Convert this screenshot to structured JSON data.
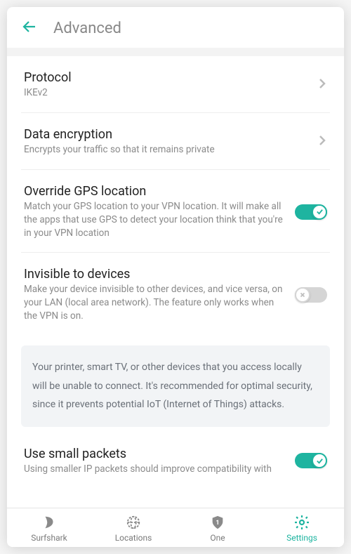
{
  "header": {
    "title": "Advanced"
  },
  "rows": {
    "protocol": {
      "title": "Protocol",
      "sub": "IKEv2"
    },
    "encryption": {
      "title": "Data encryption",
      "sub": "Encrypts your traffic so that it remains private"
    },
    "gps": {
      "title": "Override GPS location",
      "sub": "Match your GPS location to your VPN location. It will make all the apps that use GPS to detect your location think that you're in your VPN location"
    },
    "invisible": {
      "title": "Invisible to devices",
      "sub": "Make your device invisible to other devices, and vice versa, on your LAN (local area network). The feature only works when the VPN is on."
    },
    "info": "Your printer, smart TV, or other devices that you access locally will be unable to connect. It's recommended for optimal security, since it prevents potential IoT (Internet of Things) attacks.",
    "small_packets": {
      "title": "Use small packets",
      "sub": "Using smaller IP packets should improve compatibility with some routers and mobile"
    }
  },
  "nav": {
    "surfshark": "Surfshark",
    "locations": "Locations",
    "one": "One",
    "settings": "Settings"
  },
  "colors": {
    "accent": "#1eb4a0"
  }
}
